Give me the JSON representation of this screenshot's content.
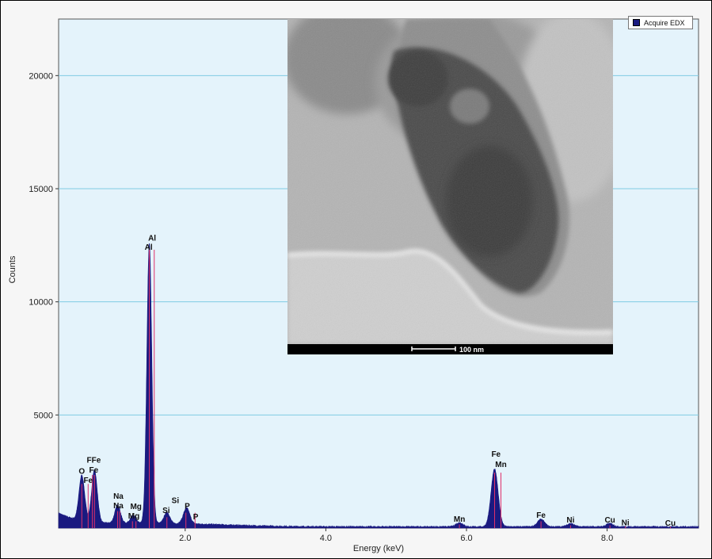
{
  "legend": {
    "label": "Acquire EDX",
    "swatch_color": "#1a1a80"
  },
  "inset": {
    "scale_bar_label": "100 nm"
  },
  "chart_data": {
    "type": "area",
    "xlabel": "Energy (keV)",
    "ylabel": "Counts",
    "xlim": [
      0.2,
      9.3
    ],
    "ylim": [
      0,
      22500
    ],
    "x_ticks": [
      2.0,
      4.0,
      6.0,
      8.0
    ],
    "x_tick_labels": [
      "2.0",
      "4.0",
      "6.0",
      "8.0"
    ],
    "y_ticks": [
      5000,
      10000,
      15000,
      20000
    ],
    "y_tick_labels": [
      "5000",
      "10000",
      "15000",
      "20000"
    ],
    "grid": "horizontal",
    "fill_color": "#1a1a80",
    "peaks": [
      {
        "x": 0.53,
        "height": 2000,
        "width": 0.04
      },
      {
        "x": 0.71,
        "height": 2300,
        "width": 0.04
      },
      {
        "x": 1.04,
        "height": 800,
        "width": 0.04
      },
      {
        "x": 1.26,
        "height": 350,
        "width": 0.04
      },
      {
        "x": 1.49,
        "height": 12400,
        "width": 0.035
      },
      {
        "x": 1.74,
        "height": 500,
        "width": 0.04
      },
      {
        "x": 2.02,
        "height": 700,
        "width": 0.045
      },
      {
        "x": 5.9,
        "height": 180,
        "width": 0.05
      },
      {
        "x": 6.4,
        "height": 2550,
        "width": 0.05
      },
      {
        "x": 7.06,
        "height": 330,
        "width": 0.05
      },
      {
        "x": 7.48,
        "height": 140,
        "width": 0.05
      },
      {
        "x": 8.04,
        "height": 140,
        "width": 0.05
      }
    ],
    "element_lines": [
      {
        "x": 0.53,
        "height": 1950
      },
      {
        "x": 0.62,
        "height": 1950
      },
      {
        "x": 0.68,
        "height": 2350
      },
      {
        "x": 0.71,
        "height": 2350
      },
      {
        "x": 1.04,
        "height": 750
      },
      {
        "x": 1.07,
        "height": 750
      },
      {
        "x": 1.25,
        "height": 300
      },
      {
        "x": 1.3,
        "height": 300
      },
      {
        "x": 1.49,
        "height": 12300
      },
      {
        "x": 1.56,
        "height": 12300
      },
      {
        "x": 1.74,
        "height": 480
      },
      {
        "x": 2.01,
        "height": 680
      },
      {
        "x": 2.14,
        "height": 680
      },
      {
        "x": 5.9,
        "height": 160
      },
      {
        "x": 6.4,
        "height": 2450
      },
      {
        "x": 6.49,
        "height": 2450
      },
      {
        "x": 7.06,
        "height": 300
      },
      {
        "x": 7.48,
        "height": 120
      },
      {
        "x": 8.04,
        "height": 120
      },
      {
        "x": 8.26,
        "height": 80
      },
      {
        "x": 8.9,
        "height": 60
      }
    ],
    "element_labels": [
      {
        "text": "O",
        "x": 0.53,
        "y": 2400
      },
      {
        "text": "Fe",
        "x": 0.62,
        "y": 2000
      },
      {
        "text": "FFe",
        "x": 0.7,
        "y": 2900
      },
      {
        "text": "Fe",
        "x": 0.7,
        "y": 2450
      },
      {
        "text": "Na",
        "x": 1.05,
        "y": 1300
      },
      {
        "text": "Na",
        "x": 1.05,
        "y": 880
      },
      {
        "text": "Mg",
        "x": 1.3,
        "y": 840
      },
      {
        "text": "Mg",
        "x": 1.27,
        "y": 420
      },
      {
        "text": "Al",
        "x": 1.53,
        "y": 12700
      },
      {
        "text": "Al",
        "x": 1.48,
        "y": 12300
      },
      {
        "text": "Si",
        "x": 1.86,
        "y": 1100
      },
      {
        "text": "Si",
        "x": 1.73,
        "y": 660
      },
      {
        "text": "P",
        "x": 2.03,
        "y": 860
      },
      {
        "text": "P",
        "x": 2.15,
        "y": 380
      },
      {
        "text": "Mn",
        "x": 5.9,
        "y": 280
      },
      {
        "text": "Fe",
        "x": 6.42,
        "y": 3150
      },
      {
        "text": "Mn",
        "x": 6.49,
        "y": 2700
      },
      {
        "text": "Fe",
        "x": 7.06,
        "y": 450
      },
      {
        "text": "Ni",
        "x": 7.48,
        "y": 250
      },
      {
        "text": "Cu",
        "x": 8.04,
        "y": 250
      },
      {
        "text": "Ni",
        "x": 8.26,
        "y": 130
      },
      {
        "text": "Cu",
        "x": 8.9,
        "y": 110
      }
    ]
  }
}
